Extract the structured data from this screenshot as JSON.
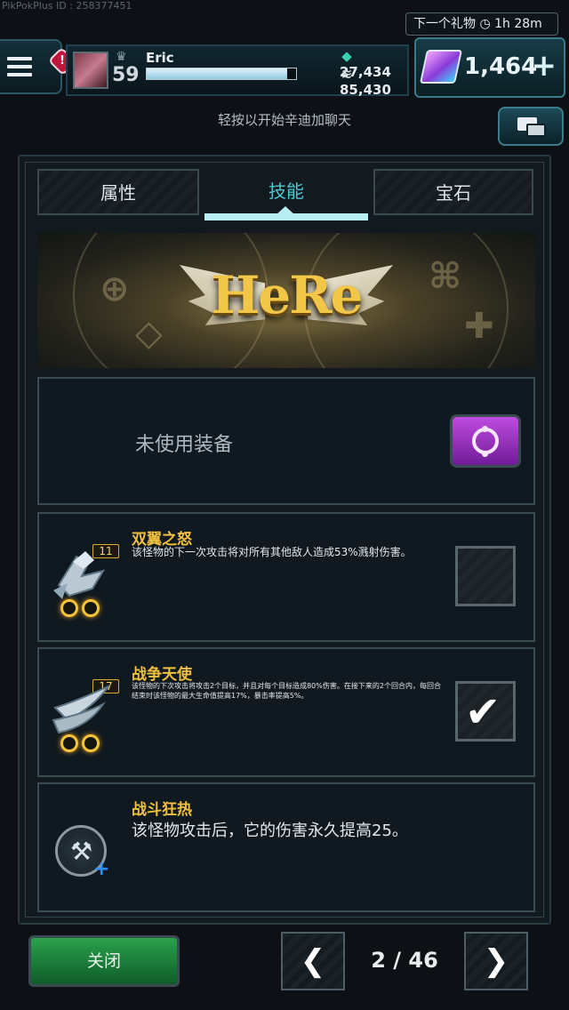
{
  "header": {
    "pikpok_id": "PikPokPlus ID : 258377451",
    "alert_badge": "!",
    "player": {
      "level": "59",
      "name": "Eric",
      "xp_progress": 0.94
    },
    "resources": {
      "gems_small": "27,434",
      "coins": "85,430"
    },
    "gift": {
      "label": "下一个礼物",
      "time": "1h 28m"
    },
    "premium_gems": "1,464",
    "plus_label": "+"
  },
  "chat": {
    "hint": "轻按以开始辛迪加聊天"
  },
  "tabs": [
    {
      "label": "属性",
      "active": false
    },
    {
      "label": "技能",
      "active": true
    },
    {
      "label": "宝石",
      "active": false
    }
  ],
  "banner": {
    "logo_text": "HeRe"
  },
  "equipment": {
    "status_text": "未使用装备"
  },
  "skills": [
    {
      "name": "双翼之怒",
      "level": "11",
      "description": "该怪物的下一次攻击将对所有其他敌人造成53%溅射伤害。",
      "checked": false
    },
    {
      "name": "战争天使",
      "level": "17",
      "description": "该怪物的下次攻击将攻击2个目标，并且对每个目标造成80%伤害。在接下来的2个回合内，每回合结束时该怪物的最大生命值提高17%，暴击率提高5%。",
      "checked": true
    },
    {
      "name": "战斗狂热",
      "description": "该怪物攻击后，它的伤害永久提高25。"
    }
  ],
  "footer": {
    "close_label": "关闭",
    "prev_label": "❮",
    "next_label": "❯",
    "page": "2 / 46"
  },
  "colors": {
    "accent": "#4bc7cf",
    "gold": "#f0c13f",
    "close_green": "#2aa14d",
    "swap_purple": "#a336c8"
  },
  "icons": {
    "menu": "hamburger-icon",
    "gem": "gem-icon",
    "coin": "coin-stack-icon",
    "clock": "clock-icon",
    "chat": "chat-bubbles-icon",
    "swap": "swap-cycle-icon",
    "check": "checkmark-icon",
    "axe": "axe-plus-icon"
  }
}
